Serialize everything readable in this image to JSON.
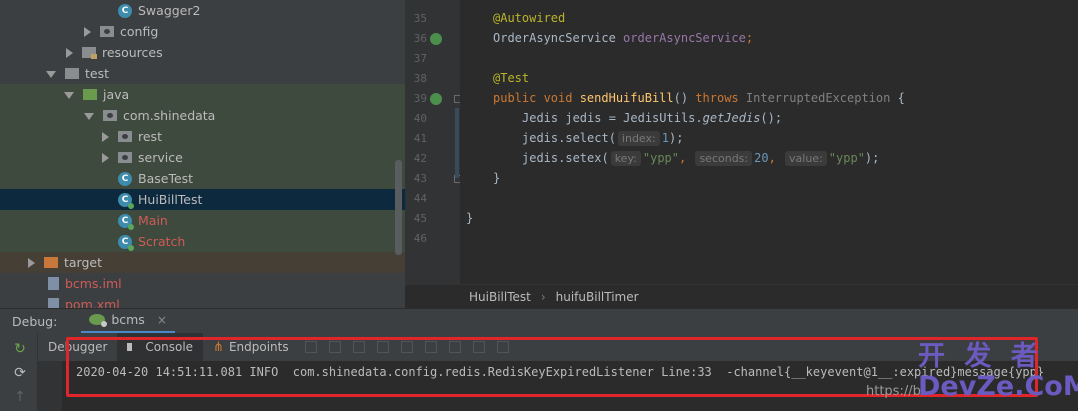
{
  "project_tree": [
    {
      "label": "Swagger2",
      "type": "class"
    },
    {
      "label": "config",
      "type": "package"
    },
    {
      "label": "resources",
      "type": "resources"
    },
    {
      "label": "test",
      "type": "folder"
    },
    {
      "label": "java",
      "type": "test-root"
    },
    {
      "label": "com.shinedata",
      "type": "package"
    },
    {
      "label": "rest",
      "type": "package"
    },
    {
      "label": "service",
      "type": "package"
    },
    {
      "label": "BaseTest",
      "type": "class"
    },
    {
      "label": "HuiBillTest",
      "type": "class-run"
    },
    {
      "label": "Main",
      "type": "class-run"
    },
    {
      "label": "Scratch",
      "type": "class-run"
    },
    {
      "label": "target",
      "type": "excluded"
    },
    {
      "label": "bcms.iml",
      "type": "file"
    },
    {
      "label": "pom.xml",
      "type": "file"
    }
  ],
  "editor": {
    "line_numbers": [
      "35",
      "36",
      "37",
      "38",
      "39",
      "40",
      "41",
      "42",
      "43",
      "44",
      "45",
      "46"
    ],
    "code": {
      "l35_ann": "@Autowired",
      "l36_type": "OrderAsyncService ",
      "l36_field": "orderAsyncService",
      "l36_end": ";",
      "l38_ann": "@Test",
      "l39_kw": "public void ",
      "l39_fn": "sendHuifuBill",
      "l39_paren": "() ",
      "l39_throws": "throws ",
      "l39_exc": "InterruptedException",
      "l39_brace": " {",
      "l40_a": "Jedis jedis = JedisUtils.",
      "l40_b": "getJedis",
      "l40_c": "();",
      "l41_a": "jedis.select(",
      "l41_hint": "index:",
      "l41_num": "1",
      "l41_end": ");",
      "l42_a": "jedis.setex(",
      "l42_h1": "key:",
      "l42_s1": "\"ypp\"",
      "l42_c1": ", ",
      "l42_h2": "seconds:",
      "l42_n": "20",
      "l42_c2": ", ",
      "l42_h3": "value:",
      "l42_s2": "\"ypp\"",
      "l42_end": ");",
      "l43": "}",
      "l45": "}"
    }
  },
  "breadcrumb": [
    "HuiBillTest",
    "huifuBillTimer"
  ],
  "debug": {
    "label": "Debug:",
    "session": "bcms",
    "close": "×",
    "tabs": [
      "Debugger",
      "Console",
      "Endpoints"
    ],
    "log_line": "2020-04-20 14:51:11.081 INFO  com.shinedata.config.redis.RedisKeyExpiredListener Line:33  -channel{__keyevent@1__:expired}message{ypp}"
  },
  "watermark": {
    "line1": "开 发 者",
    "line2": "DevZe.CoM",
    "url": "https://b"
  }
}
